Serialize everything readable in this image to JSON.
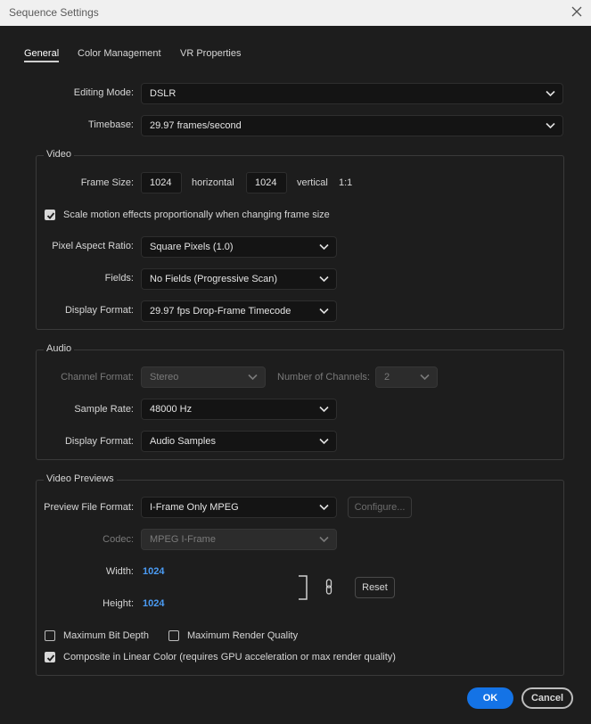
{
  "window": {
    "title": "Sequence Settings"
  },
  "tabs": [
    "General",
    "Color Management",
    "VR Properties"
  ],
  "general": {
    "editing_mode": {
      "label": "Editing Mode:",
      "value": "DSLR"
    },
    "timebase": {
      "label": "Timebase:",
      "value": "29.97  frames/second"
    }
  },
  "video": {
    "title": "Video",
    "frame_size_label": "Frame Size:",
    "horizontal_value": "1024",
    "horizontal_label": "horizontal",
    "vertical_value": "1024",
    "vertical_label": "vertical",
    "ratio": "1:1",
    "scale_motion_label": "Scale motion effects proportionally when changing frame size",
    "scale_motion_checked": true,
    "pixel_aspect": {
      "label": "Pixel Aspect Ratio:",
      "value": "Square Pixels (1.0)"
    },
    "fields": {
      "label": "Fields:",
      "value": "No Fields (Progressive Scan)"
    },
    "display_format": {
      "label": "Display Format:",
      "value": "29.97 fps Drop-Frame Timecode"
    }
  },
  "audio": {
    "title": "Audio",
    "channel_format": {
      "label": "Channel Format:",
      "value": "Stereo"
    },
    "num_channels": {
      "label": "Number of Channels:",
      "value": "2"
    },
    "sample_rate": {
      "label": "Sample Rate:",
      "value": "48000 Hz"
    },
    "display_format": {
      "label": "Display Format:",
      "value": "Audio Samples"
    }
  },
  "previews": {
    "title": "Video Previews",
    "preview_format": {
      "label": "Preview File Format:",
      "value": "I-Frame Only MPEG"
    },
    "configure_label": "Configure...",
    "codec": {
      "label": "Codec:",
      "value": "MPEG I-Frame"
    },
    "width_label": "Width:",
    "width_value": "1024",
    "height_label": "Height:",
    "height_value": "1024",
    "reset_label": "Reset"
  },
  "options": {
    "max_bit_depth": {
      "label": "Maximum Bit Depth",
      "checked": false
    },
    "max_render_quality": {
      "label": "Maximum Render Quality",
      "checked": false
    },
    "linear_color": {
      "label": "Composite in Linear Color (requires GPU acceleration or max render quality)",
      "checked": true
    }
  },
  "footer": {
    "ok_label": "OK",
    "cancel_label": "Cancel"
  },
  "colors": {
    "accent": "#1473e6",
    "link": "#4b9cf5",
    "background": "#1d1d1d"
  },
  "icons": {
    "close": "close-icon",
    "chevron": "chevron-down-icon",
    "link": "link-icon",
    "check": "checkmark-icon"
  }
}
